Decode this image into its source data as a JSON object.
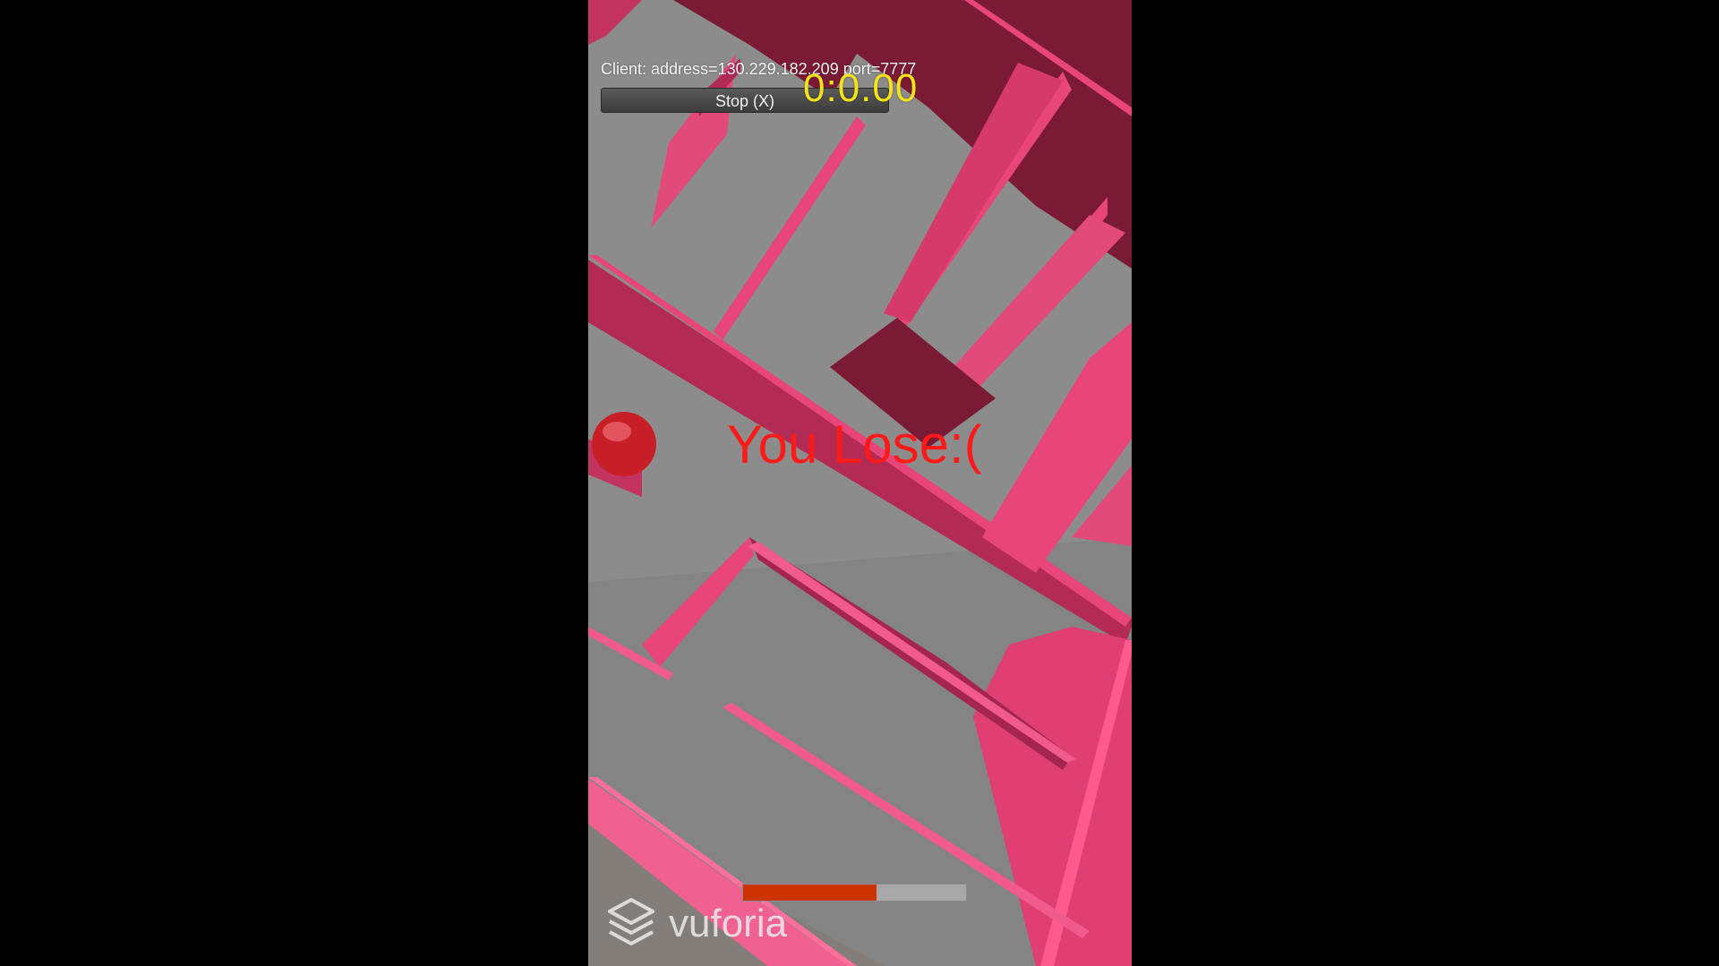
{
  "client": {
    "info_text": "Client: address=130.229.182.209 port=7777"
  },
  "controls": {
    "stop_label": "Stop (X)"
  },
  "hud": {
    "timer": "0:0.00",
    "game_message": "You Lose:(",
    "progress_fraction": 0.6
  },
  "watermark": {
    "text": "vuforia"
  },
  "colors": {
    "background": "#000000",
    "maze_floor": "#8e8e8e",
    "maze_wall": "#e8457a",
    "maze_wall_dark": "#7a1a35",
    "ball": "#c81e28",
    "timer": "#f5e21b",
    "message": "#ff1a1a",
    "progress_fill": "#cc3300"
  }
}
